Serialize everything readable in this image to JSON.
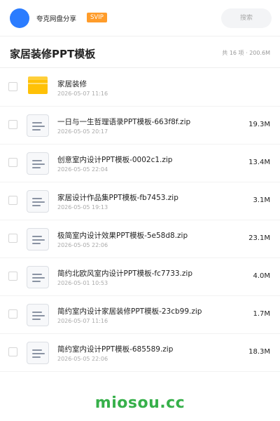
{
  "header": {
    "share_title": "夸克网盘分享",
    "svip_badge": "SVIP",
    "search_placeholder": "搜索",
    "accent_color": "#2b7cff",
    "badge_color": "#ff9c2a"
  },
  "folder": {
    "title": "家居装修PPT模板",
    "meta": "共 16 项 · 200.6M"
  },
  "files": [
    {
      "name": "家居装修",
      "date": "2026-05-07 11:16",
      "size": "",
      "icon": "folder-icon"
    },
    {
      "name": "一日与一生哲理语录PPT模板-663f8f.zip",
      "date": "2026-05-05 20:17",
      "size": "19.3M",
      "icon": "zip-file-icon"
    },
    {
      "name": "创意室内设计PPT模板-0002c1.zip",
      "date": "2026-05-05 22:04",
      "size": "13.4M",
      "icon": "zip-file-icon"
    },
    {
      "name": "家居设计作品集PPT模板-fb7453.zip",
      "date": "2026-05-05 19:13",
      "size": "3.1M",
      "icon": "zip-file-icon"
    },
    {
      "name": "极简室内设计效果PPT模板-5e58d8.zip",
      "date": "2026-05-05 22:06",
      "size": "23.1M",
      "icon": "zip-file-icon"
    },
    {
      "name": "简约北欧风室内设计PPT模板-fc7733.zip",
      "date": "2026-05-01 10:53",
      "size": "4.0M",
      "icon": "zip-file-icon"
    },
    {
      "name": "简约室内设计家居装修PPT模板-23cb99.zip",
      "date": "2026-05-07 11:16",
      "size": "1.7M",
      "icon": "zip-file-icon"
    },
    {
      "name": "简约室内设计PPT模板-685589.zip",
      "date": "2026-05-05 22:06",
      "size": "18.3M",
      "icon": "zip-file-icon"
    }
  ],
  "footer": {
    "watermark": "miosou.cc",
    "watermark_color": "#36b04a"
  }
}
